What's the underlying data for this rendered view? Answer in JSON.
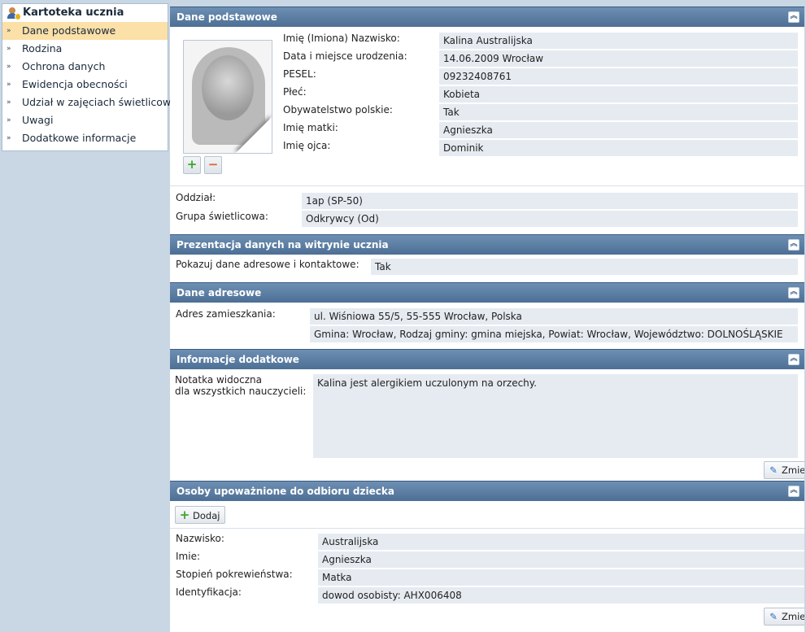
{
  "nav": {
    "title": "Kartoteka ucznia",
    "items": [
      {
        "label": "Dane podstawowe"
      },
      {
        "label": "Rodzina"
      },
      {
        "label": "Ochrona danych"
      },
      {
        "label": "Ewidencja obecności"
      },
      {
        "label": "Udział w zajęciach świetlicowych"
      },
      {
        "label": "Uwagi"
      },
      {
        "label": "Dodatkowe informacje"
      }
    ],
    "arrow": "»"
  },
  "basic": {
    "header": "Dane podstawowe",
    "fields": [
      {
        "label": "Imię (Imiona) Nazwisko:",
        "value": "Kalina Australijska"
      },
      {
        "label": "Data i miejsce urodzenia:",
        "value": "14.06.2009 Wrocław"
      },
      {
        "label": "PESEL:",
        "value": "09232408761"
      },
      {
        "label": "Płeć:",
        "value": "Kobieta"
      },
      {
        "label": "Obywatelstwo polskie:",
        "value": "Tak"
      },
      {
        "label": "Imię matki:",
        "value": "Agnieszka"
      },
      {
        "label": "Imię ojca:",
        "value": "Dominik"
      }
    ],
    "class_label": "Oddział:",
    "class_value": "1ap (SP-50)",
    "group_label": "Grupa świetlicowa:",
    "group_value": "Odkrywcy (Od)"
  },
  "presentation": {
    "header": "Prezentacja danych na witrynie ucznia",
    "label": "Pokazuj dane adresowe i kontaktowe:",
    "value": "Tak"
  },
  "address": {
    "header": "Dane adresowe",
    "label": "Adres zamieszkania:",
    "line1": "ul. Wiśniowa 55/5, 55-555 Wrocław, Polska",
    "line2": "Gmina: Wrocław, Rodzaj gminy: gmina miejska, Powiat: Wrocław, Województwo: DOLNOŚLĄSKIE"
  },
  "extra": {
    "header": "Informacje dodatkowe",
    "label_line1": "Notatka widoczna",
    "label_line2": "dla wszystkich nauczycieli:",
    "note": "Kalina jest alergikiem uczulonym na orzechy.",
    "change_button": "Zmień"
  },
  "pickup": {
    "header": "Osoby upoważnione do odbioru dziecka",
    "add_button": "Dodaj",
    "fields": [
      {
        "label": "Nazwisko:",
        "value": "Australijska"
      },
      {
        "label": "Imie:",
        "value": "Agnieszka"
      },
      {
        "label": "Stopień pokrewieństwa:",
        "value": "Matka"
      },
      {
        "label": "Identyfikacja:",
        "value": "dowod osobisty: AHX006408"
      }
    ],
    "change_button": "Zmień"
  },
  "icons": {
    "collapse": "double-chevron-up-icon",
    "photo_add": "plus-icon",
    "photo_remove": "minus-icon",
    "edit": "pencil-icon"
  },
  "colors": {
    "section_header": "#5b7ea5",
    "active_nav": "#fbe0a8",
    "field_bg": "#e6ebf1",
    "page_bg": "#c9d6e3"
  }
}
